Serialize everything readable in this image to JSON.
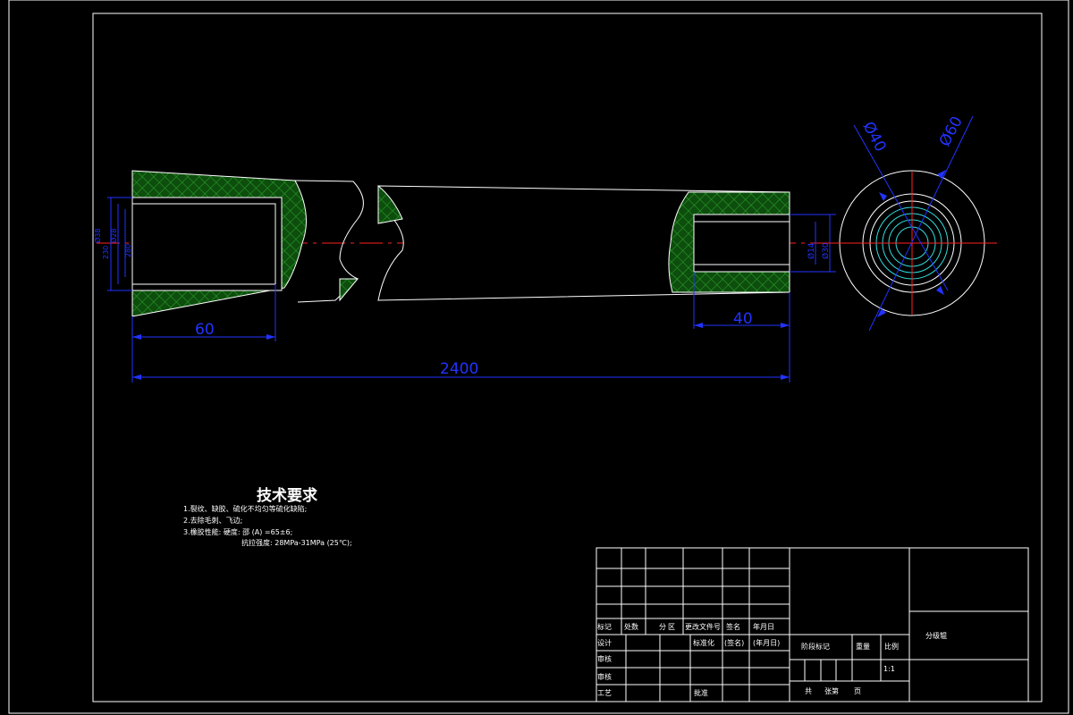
{
  "colors": {
    "background": "#000000",
    "outline": "#ffffff",
    "dimension": "#2233ff",
    "centerline": "#ff2020",
    "hatch": "#1a8a1a",
    "circle_inner": "#33dddd"
  },
  "dimensions": {
    "overall_length": "2400",
    "left_bore_depth": "60",
    "right_bore_depth": "40",
    "left_dia_1": "Ø38",
    "left_dia_2": "Ø28",
    "left_dia_3": "230",
    "left_dia_4": "280",
    "right_dia_1": "Ø14",
    "right_dia_2": "Ø30",
    "end_dia_inner": "Ø40",
    "end_dia_outer": "Ø60"
  },
  "tech_requirements": {
    "title": "技术要求",
    "line1": "1.裂纹、缺胶、硫化不均匀等硫化缺陷;",
    "line2": "2.去除毛刺、飞边;",
    "line3": "3.橡胶性能: 硬度: 邵 (A) =65±6;",
    "line4": "抗拉强度: 28MPa-31MPa (25℃);"
  },
  "title_block": {
    "part_name": "分级辊",
    "scale": "1:1",
    "h_mark": "标记",
    "h_count": "处数",
    "h_zone": "分",
    "h_zone2": "区",
    "h_docno": "更改文件号",
    "h_sign": "签名",
    "h_date": "年月日",
    "h_design": "设计",
    "h_std": "标准化",
    "h_sign2": "(签名)",
    "h_date2": "(年月日)",
    "h_stage": "阶段标记",
    "h_weight": "重量",
    "h_ratio": "比例",
    "h_check": "审核",
    "h_review": "审核",
    "h_process": "工艺",
    "h_approve": "批准",
    "h_total": "共",
    "h_sheet": "张第",
    "h_page": "页"
  }
}
